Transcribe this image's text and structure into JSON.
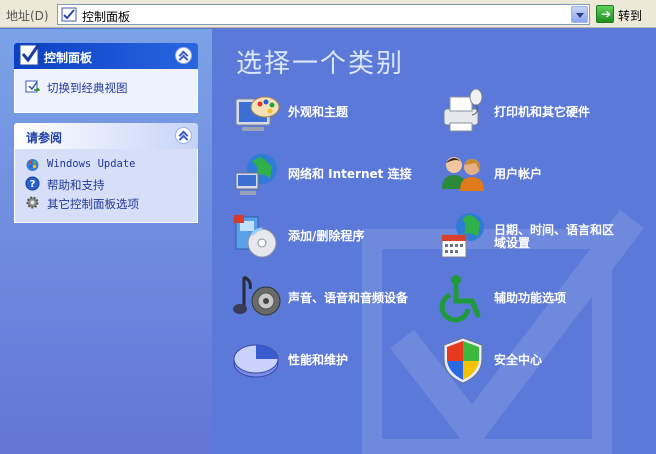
{
  "address_bar": {
    "label": "地址(D)",
    "value": "控制面板",
    "go_label": "转到"
  },
  "left_pane": {
    "panel1": {
      "title": "控制面板",
      "links": [
        {
          "label": "切换到经典视图",
          "icon": "classic-view-icon"
        }
      ]
    },
    "panel2": {
      "title": "请参阅",
      "links": [
        {
          "label": "Windows Update",
          "icon": "windows-update-icon"
        },
        {
          "label": "帮助和支持",
          "icon": "help-icon"
        },
        {
          "label": "其它控制面板选项",
          "icon": "gear-icon"
        }
      ]
    }
  },
  "main": {
    "heading": "选择一个类别",
    "categories": [
      {
        "label": "外观和主题",
        "icon": "appearance-themes-icon"
      },
      {
        "label": "打印机和其它硬件",
        "icon": "printer-hardware-icon"
      },
      {
        "label": "网络和 Internet 连接",
        "icon": "network-internet-icon"
      },
      {
        "label": "用户帐户",
        "icon": "user-accounts-icon"
      },
      {
        "label": "添加/删除程序",
        "icon": "add-remove-programs-icon"
      },
      {
        "label": "日期、时间、语言和区",
        "label2": "域设置",
        "icon": "date-time-language-icon"
      },
      {
        "label": "声音、语音和音频设备",
        "icon": "sounds-audio-icon"
      },
      {
        "label": "辅助功能选项",
        "icon": "accessibility-icon"
      },
      {
        "label": "性能和维护",
        "icon": "performance-maintenance-icon"
      },
      {
        "label": "安全中心",
        "icon": "security-center-icon"
      }
    ]
  }
}
